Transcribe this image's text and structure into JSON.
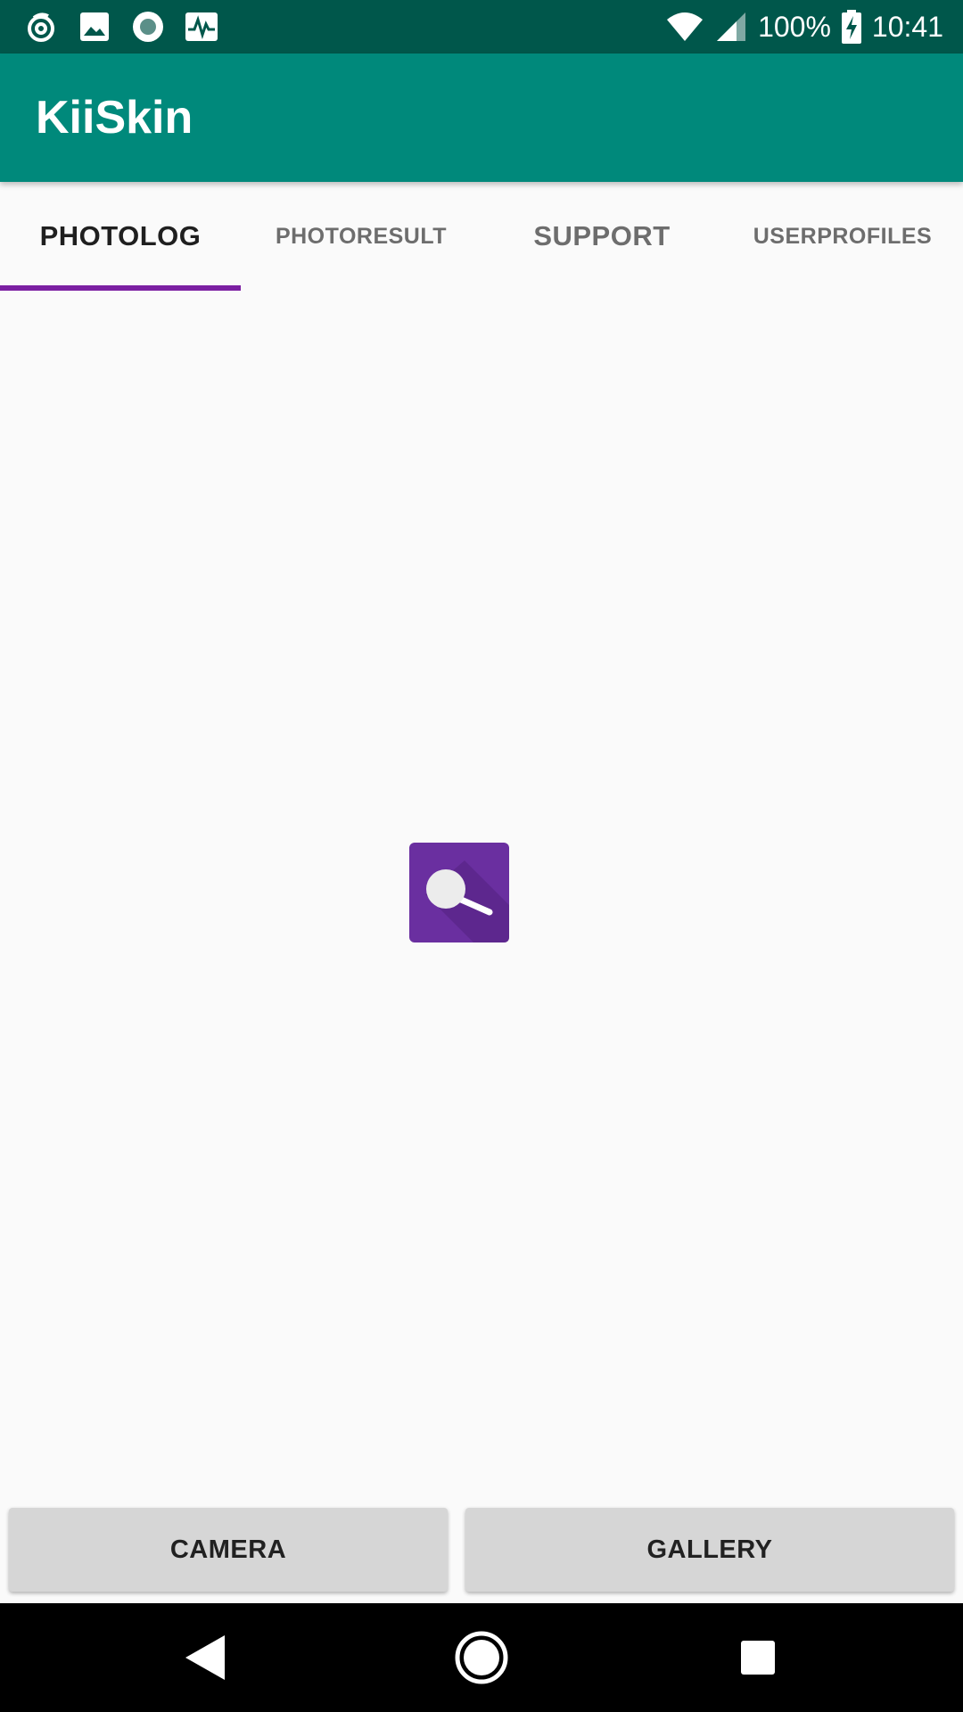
{
  "status_bar": {
    "battery": "100%",
    "time": "10:41",
    "left_icons": [
      "sync-notification-icon",
      "image-notification-icon",
      "record-notification-icon",
      "activity-notification-icon"
    ],
    "right_icons": [
      "wifi-icon",
      "cellular-signal-icon",
      "battery-charging-icon"
    ],
    "background": "#00574b"
  },
  "app_bar": {
    "title": "KiiSkin",
    "background": "#00897b"
  },
  "tabs": [
    {
      "label": "PHOTOLOG",
      "selected": true
    },
    {
      "label": "PHOTORESULT",
      "selected": false
    },
    {
      "label": "SUPPORT",
      "selected": false
    },
    {
      "label": "USERPROFILES",
      "selected": false
    }
  ],
  "tab_indicator_color": "#7b1fa2",
  "content": {
    "center_icon": "magnifier-app-icon",
    "icon_color": "#6a2fa0"
  },
  "buttons": {
    "camera_label": "CAMERA",
    "gallery_label": "GALLERY"
  },
  "nav_bar": {
    "icons": [
      "back-icon",
      "home-icon",
      "recents-icon"
    ]
  }
}
